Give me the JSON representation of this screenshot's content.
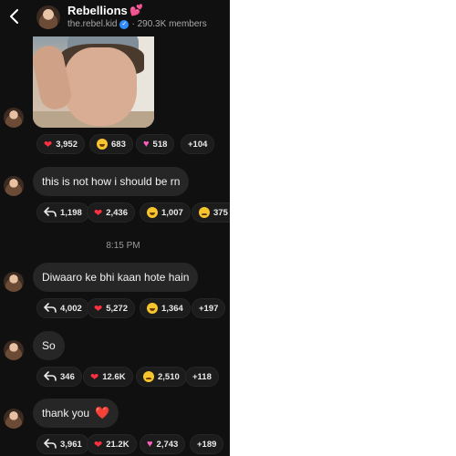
{
  "header": {
    "title": "Rebellions",
    "title_emoji": "💕",
    "username": "the.rebel.kid",
    "members": "· 290.3K members"
  },
  "messages": [
    {
      "type": "photo",
      "reactions": [
        {
          "icon": "red-heart-icon",
          "count": "3,952"
        },
        {
          "icon": "laughing-emoji-icon",
          "count": "683"
        },
        {
          "icon": "pink-heart-icon",
          "count": "518"
        },
        {
          "icon": "",
          "count": "+104"
        }
      ]
    },
    {
      "type": "text",
      "text": "this is not how i should be rn",
      "reactions": [
        {
          "icon": "reply-icon",
          "count": "1,198"
        },
        {
          "icon": "red-heart-icon",
          "count": "2,436"
        },
        {
          "icon": "laughing-emoji-icon",
          "count": "1,007"
        },
        {
          "icon": "sad-emoji-icon",
          "count": "375"
        }
      ]
    },
    {
      "type": "text",
      "text": "Diwaaro ke bhi kaan hote hain",
      "reactions": [
        {
          "icon": "reply-icon",
          "count": "4,002"
        },
        {
          "icon": "red-heart-icon",
          "count": "5,272"
        },
        {
          "icon": "laughing-emoji-icon",
          "count": "1,364"
        },
        {
          "icon": "",
          "count": "+197"
        }
      ]
    },
    {
      "type": "text",
      "text": "So",
      "reactions": [
        {
          "icon": "reply-icon",
          "count": "346"
        },
        {
          "icon": "red-heart-icon",
          "count": "12.6K"
        },
        {
          "icon": "sad-emoji-icon",
          "count": "2,510"
        },
        {
          "icon": "",
          "count": "+118"
        }
      ]
    },
    {
      "type": "text",
      "text": "thank you",
      "text_emoji": "❤️",
      "reactions": [
        {
          "icon": "reply-icon",
          "count": "3,961"
        },
        {
          "icon": "red-heart-icon",
          "count": "21.2K"
        },
        {
          "icon": "pink-heart-icon",
          "count": "2,743"
        },
        {
          "icon": "",
          "count": "+189"
        }
      ]
    }
  ],
  "timestamp": "8:15 PM"
}
